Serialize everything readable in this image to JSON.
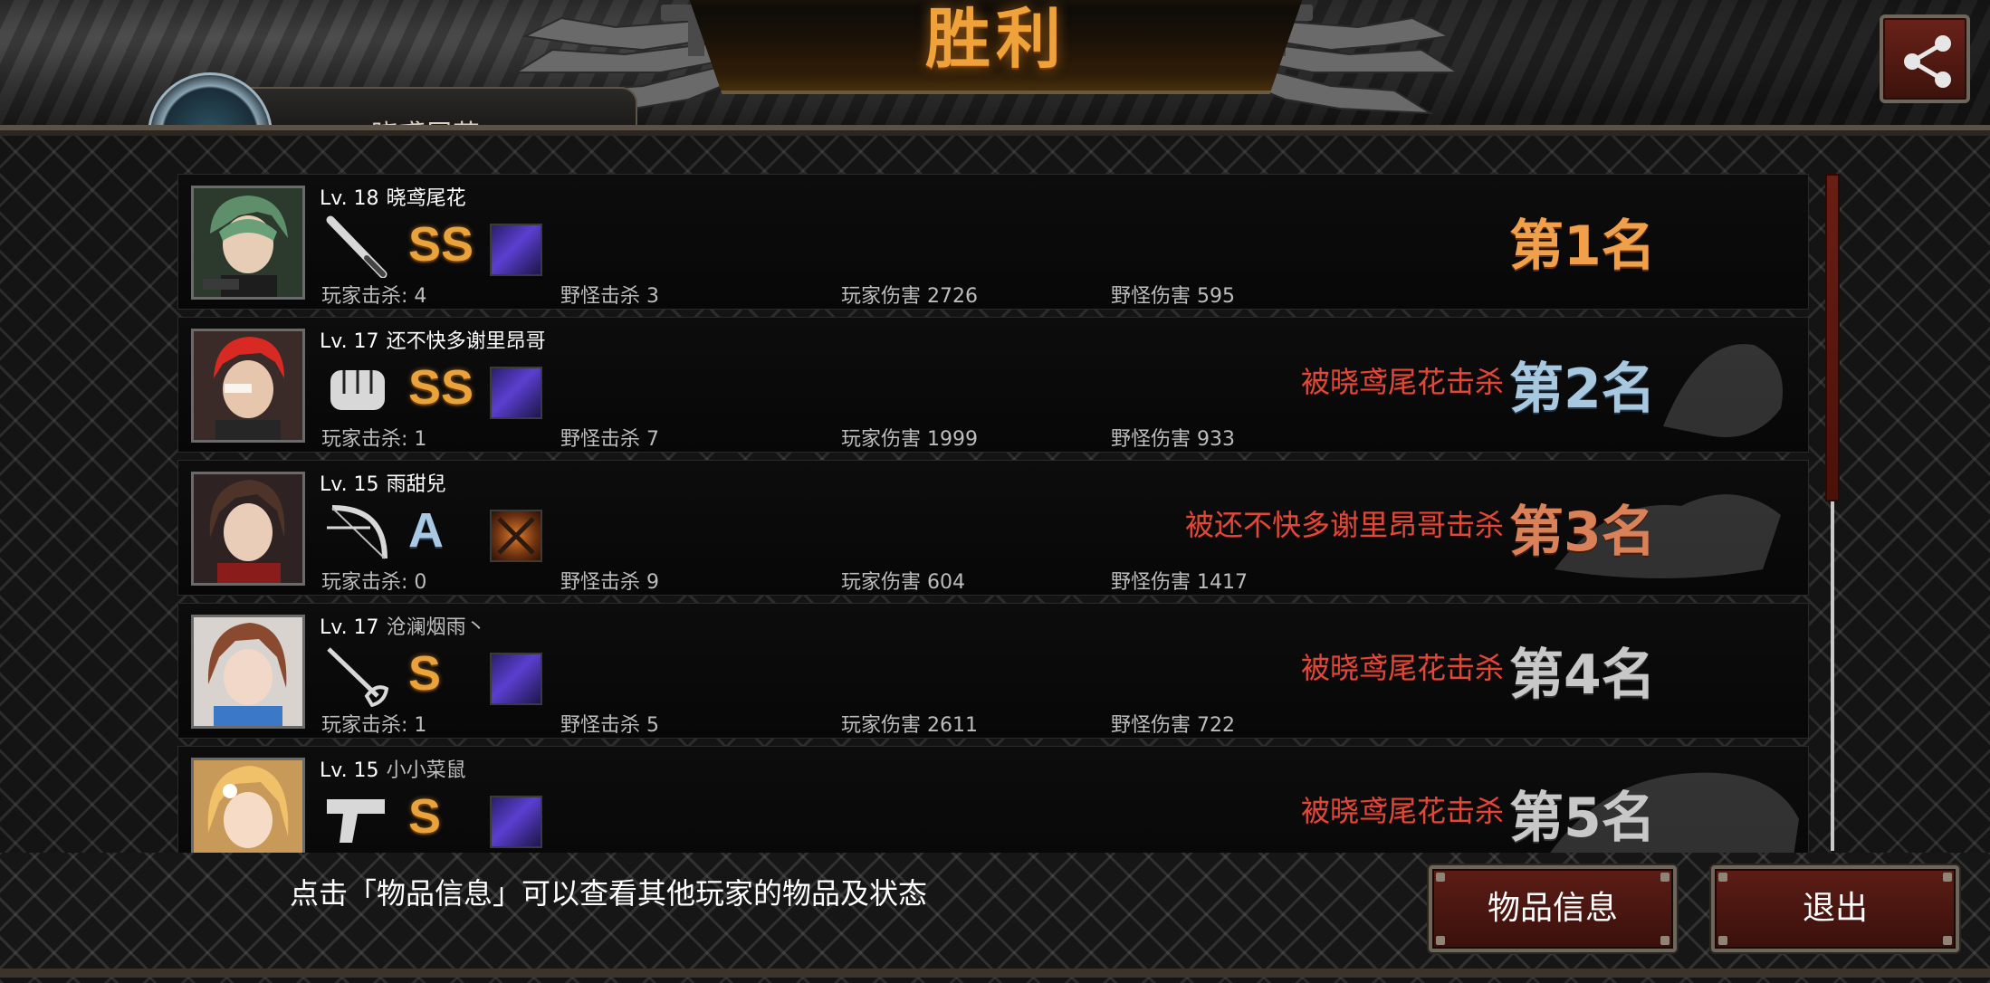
{
  "header": {
    "title": "胜利",
    "player_name_partial": "晓鸢尾花"
  },
  "players": [
    {
      "level": "Lv. 18",
      "name": "晓鸢尾花",
      "weapon": "bat-icon",
      "grade": "SS",
      "item": "purple-box-icon",
      "killed_by": "",
      "rank": "第1名",
      "stats": {
        "player_kills": "玩家击杀: 4",
        "monster_kills": "野怪击杀 3",
        "player_damage": "玩家伤害 2726",
        "monster_damage": "野怪伤害 595"
      }
    },
    {
      "level": "Lv. 17",
      "name": "还不快多谢里昂哥",
      "weapon": "fist-icon",
      "grade": "SS",
      "item": "purple-box-icon",
      "killed_by": "被晓鸢尾花击杀",
      "rank": "第2名",
      "stats": {
        "player_kills": "玩家击杀: 1",
        "monster_kills": "野怪击杀 7",
        "player_damage": "玩家伤害 1999",
        "monster_damage": "野怪伤害 933"
      }
    },
    {
      "level": "Lv. 15",
      "name": "雨甜兒",
      "weapon": "bow-icon",
      "grade": "A",
      "item": "crossed-blades-icon",
      "killed_by": "被还不快多谢里昂哥击杀",
      "rank": "第3名",
      "stats": {
        "player_kills": "玩家击杀: 0",
        "monster_kills": "野怪击杀 9",
        "player_damage": "玩家伤害 604",
        "monster_damage": "野怪伤害 1417"
      }
    },
    {
      "level": "Lv. 17",
      "name": "沧澜烟雨丶",
      "weapon": "rapier-icon",
      "grade": "S",
      "item": "purple-box-icon",
      "killed_by": "被晓鸢尾花击杀",
      "rank": "第4名",
      "stats": {
        "player_kills": "玩家击杀: 1",
        "monster_kills": "野怪击杀 5",
        "player_damage": "玩家伤害 2611",
        "monster_damage": "野怪伤害 722"
      }
    },
    {
      "level": "Lv. 15",
      "name": "小小菜鼠",
      "weapon": "pistol-icon",
      "grade": "S",
      "item": "purple-box-icon",
      "killed_by": "被晓鸢尾花击杀",
      "rank": "第5名",
      "stats": {
        "player_kills": "",
        "monster_kills": "",
        "player_damage": "",
        "monster_damage": ""
      }
    }
  ],
  "footer": {
    "hint": "点击「物品信息」可以查看其他玩家的物品及状态",
    "items_button": "物品信息",
    "exit_button": "退出"
  },
  "colors": {
    "rank_gold": "#f0a04a",
    "rank_silver": "#a8c8e0",
    "rank_bronze": "#d9825a",
    "rank_default": "#c8c8c8",
    "killed_text": "#e0493a",
    "title": "#f0a23a"
  }
}
